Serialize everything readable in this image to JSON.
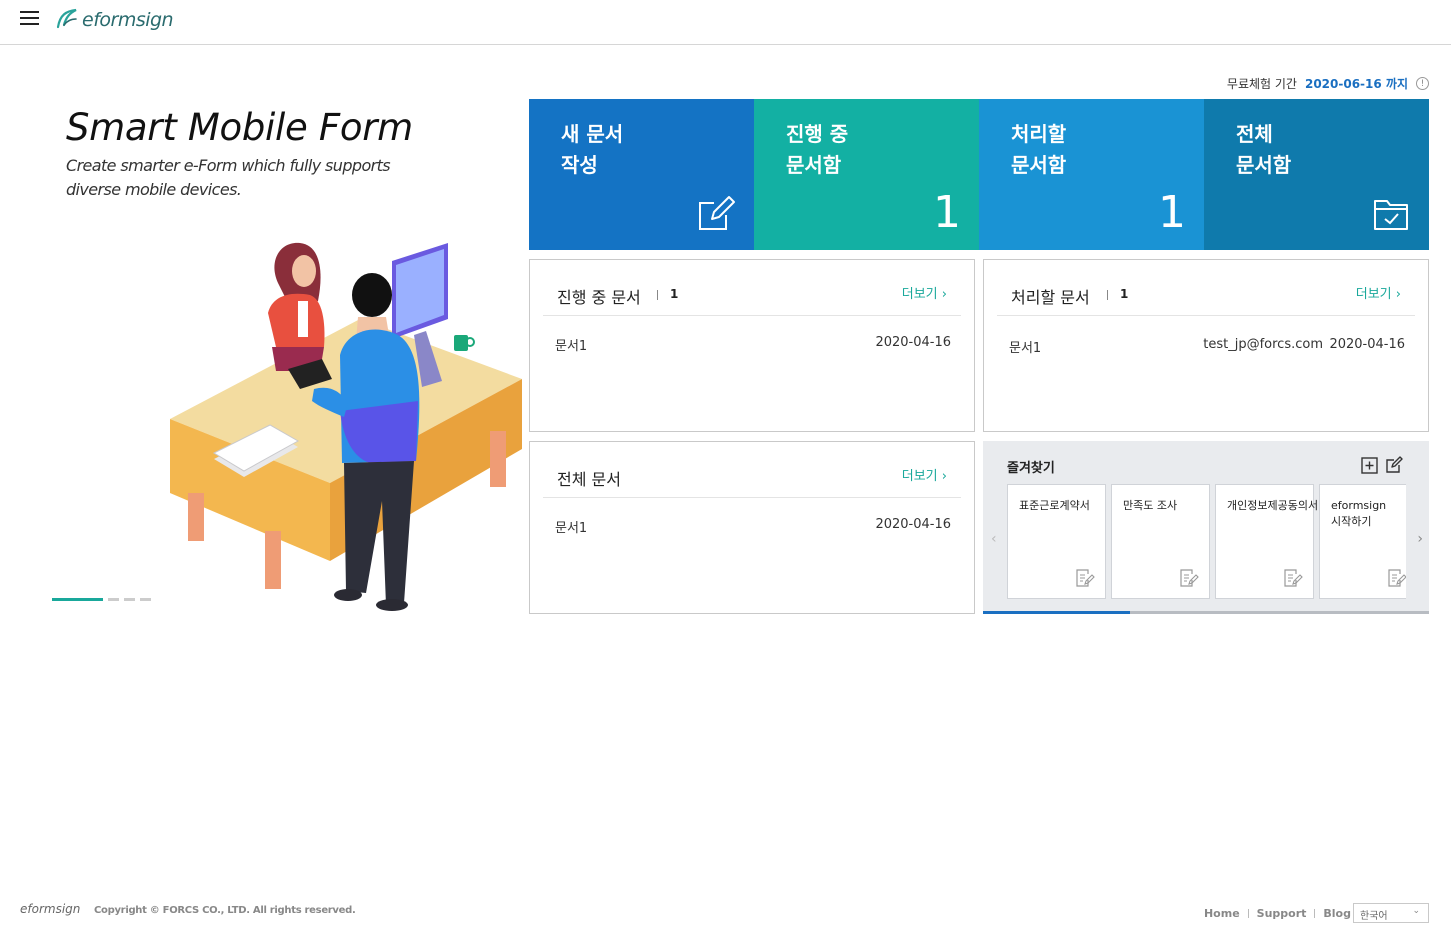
{
  "header": {
    "logo_text": "eformsign",
    "menu_icon": "hamburger-menu-icon"
  },
  "trial": {
    "label": "무료체험 기간",
    "date": "2020-06-16 까지",
    "info_icon": "info-icon"
  },
  "promo": {
    "title": "Smart Mobile Form",
    "subtitle": "Create smarter e-Form which fully supports diverse mobile devices.",
    "slides": 4,
    "active_slide": 1
  },
  "tiles": [
    {
      "line1": "새 문서",
      "line2": "작성",
      "icon": "edit-document-icon",
      "color": "#1473c4"
    },
    {
      "line1": "진행 중",
      "line2": "문서함",
      "count": "1",
      "color": "#13b0a3"
    },
    {
      "line1": "처리할",
      "line2": "문서함",
      "count": "1",
      "color": "#1a93d4"
    },
    {
      "line1": "전체",
      "line2": "문서함",
      "icon": "folder-check-icon",
      "color": "#0f7aac"
    }
  ],
  "panels": {
    "in_progress": {
      "title": "진행 중 문서",
      "count": "1",
      "more": "더보기",
      "rows": [
        {
          "name": "문서1",
          "date": "2020-04-16"
        }
      ]
    },
    "to_process": {
      "title": "처리할 문서",
      "count": "1",
      "more": "더보기",
      "rows": [
        {
          "name": "문서1",
          "email": "test_jp@forcs.com",
          "date": "2020-04-16"
        }
      ]
    },
    "all": {
      "title": "전체 문서",
      "more": "더보기",
      "rows": [
        {
          "name": "문서1",
          "date": "2020-04-16"
        }
      ]
    }
  },
  "favorites": {
    "title": "즐겨찾기",
    "cards": [
      {
        "label": "표준근로계약서"
      },
      {
        "label": "만족도 조사"
      },
      {
        "label": "개인정보제공동의서"
      },
      {
        "label": "eformsign 시작하기"
      }
    ],
    "scroll_fraction": 0.33
  },
  "footer": {
    "logo_text": "eformsign",
    "copyright": "Copyright © FORCS CO., LTD. All rights reserved.",
    "links": [
      "Home",
      "Support",
      "Blog"
    ],
    "language": "한국어"
  },
  "colors": {
    "accent_teal": "#19a89b",
    "accent_blue": "#1a6fc1"
  }
}
